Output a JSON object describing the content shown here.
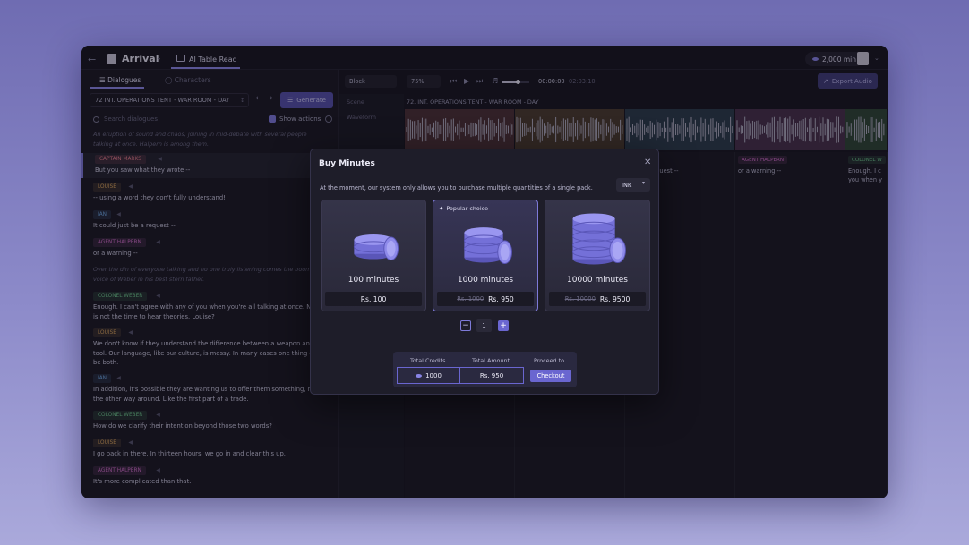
{
  "topbar": {
    "project_title": "Arrival",
    "tab_label": "AI Table Read",
    "credits": "2,000 min"
  },
  "left": {
    "tabs": [
      "Dialogues",
      "Characters"
    ],
    "scene": "72  INT. OPERATIONS TENT - WAR ROOM - DAY",
    "generate_label": "Generate",
    "search_placeholder": "Search dialogues",
    "show_actions_label": "Show actions",
    "items": [
      {
        "type": "narration",
        "text": "An eruption of sound and chaos, joining in mid-debate with several people talking at once. Halpern is among them."
      },
      {
        "type": "dialogue",
        "character": "CAPTAIN MARKS",
        "text": "But you saw what they wrote --",
        "color": "#e07a8a"
      },
      {
        "type": "dialogue",
        "character": "LOUISE",
        "text": "-- using a word they don't fully understand!",
        "color": "#d8a45c"
      },
      {
        "type": "dialogue",
        "character": "IAN",
        "text": "It could just be a request --",
        "color": "#6da5e0"
      },
      {
        "type": "dialogue",
        "character": "AGENT HALPERN",
        "text": "or a warning --",
        "color": "#d16ec8"
      },
      {
        "type": "narration",
        "text": "Over the din of everyone talking and no one truly listening comes the booming voice of Weber in his best stern father."
      },
      {
        "type": "dialogue",
        "character": "COLONEL WEBER",
        "text": "Enough. I can't agree with any of you when you're all talking at once. Now is not the time to hear theories. Louise?",
        "color": "#6cc48a"
      },
      {
        "type": "dialogue",
        "character": "LOUISE",
        "text": "We don't know if they understand the difference between a weapon and a tool. Our language, like our culture, is messy. In many cases one thing can be both.",
        "color": "#d8a45c"
      },
      {
        "type": "dialogue",
        "character": "IAN",
        "text": "In addition, it's possible they are wanting us to offer them something, not the other way around. Like the first part of a trade.",
        "color": "#6da5e0"
      },
      {
        "type": "dialogue",
        "character": "COLONEL WEBER",
        "text": "How do we clarify their intention beyond those two words?",
        "color": "#6cc48a"
      },
      {
        "type": "dialogue",
        "character": "LOUISE",
        "text": "I go back in there. In thirteen hours, we go in and clear this up.",
        "color": "#d8a45c"
      },
      {
        "type": "dialogue",
        "character": "AGENT HALPERN",
        "text": "It's more complicated than that.",
        "color": "#d16ec8"
      }
    ]
  },
  "toolbar": {
    "block_label": "Block",
    "zoom_label": "75%",
    "time_current": "00:00:00",
    "time_total": "02:03:10",
    "export_label": "Export Audio",
    "volume_level": 0.6
  },
  "timeline": {
    "track_scene_label": "Scene",
    "track_waveform_label": "Waveform",
    "scene_title": "72. INT. OPERATIONS TENT - WAR ROOM - DAY",
    "segments": [
      {
        "color": "#4a2f34"
      },
      {
        "color": "#4a3a2e"
      },
      {
        "color": "#2b3a4a"
      },
      {
        "color": "#46304a"
      },
      {
        "color": "#2e4534"
      }
    ],
    "lanes": [
      {
        "tag": "",
        "text": "",
        "color": ""
      },
      {
        "tag": "",
        "text": "",
        "color": ""
      },
      {
        "tag": "",
        "text": "st be a request --",
        "color": ""
      },
      {
        "tag": "AGENT HALPERN",
        "text": "or a warning --",
        "color": "#d16ec8"
      },
      {
        "tag": "COLONEL W",
        "text": "Enough. I c you when y",
        "color": "#6cc48a"
      }
    ]
  },
  "modal": {
    "title": "Buy Minutes",
    "description": "At the moment, our system only allows you to purchase multiple quantities of a single pack.",
    "currency": "INR",
    "popular_label": "Popular choice",
    "packs": [
      {
        "name": "100 minutes",
        "original_price": "",
        "price": "Rs. 100"
      },
      {
        "name": "1000 minutes",
        "original_price": "Rs. 1000",
        "price": "Rs. 950"
      },
      {
        "name": "10000 minutes",
        "original_price": "Rs. 10000",
        "price": "Rs. 9500"
      }
    ],
    "quantity": "1",
    "summary": {
      "credits_label": "Total Credits",
      "amount_label": "Total Amount",
      "proceed_label": "Proceed to",
      "credits_value": "1000",
      "amount_value": "Rs. 950",
      "checkout_label": "Checkout"
    }
  }
}
